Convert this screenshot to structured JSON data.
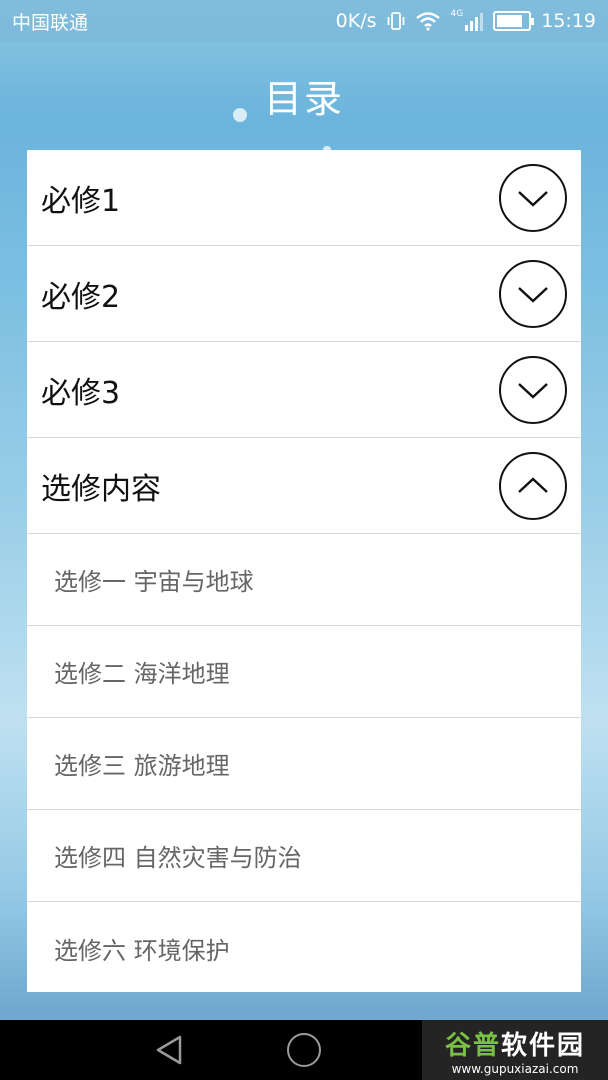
{
  "status_bar": {
    "carrier": "中国联通",
    "speed": "0K/s",
    "network": "4G",
    "time": "15:19",
    "battery_level": 0.85
  },
  "header": {
    "title": "目录"
  },
  "sections": [
    {
      "label": "必修1",
      "expanded": false,
      "icon": "chevron-down-icon"
    },
    {
      "label": "必修2",
      "expanded": false,
      "icon": "chevron-down-icon"
    },
    {
      "label": "必修3",
      "expanded": false,
      "icon": "chevron-down-icon"
    },
    {
      "label": "选修内容",
      "expanded": true,
      "icon": "chevron-up-icon"
    }
  ],
  "electives": [
    "选修一 宇宙与地球",
    "选修二 海洋地理",
    "选修三 旅游地理",
    "选修四 自然灾害与防治",
    "选修六 环境保护"
  ],
  "nav_bar": {
    "back": "back-icon",
    "home": "home-icon"
  },
  "watermark": {
    "brand_green": "谷普",
    "brand_white": "软件园",
    "url": "www.gupuxiazai.com"
  },
  "colors": {
    "panel": "#ffffff",
    "title": "#ffffff",
    "sub_text": "#666666",
    "brand_green": "#79c144"
  }
}
